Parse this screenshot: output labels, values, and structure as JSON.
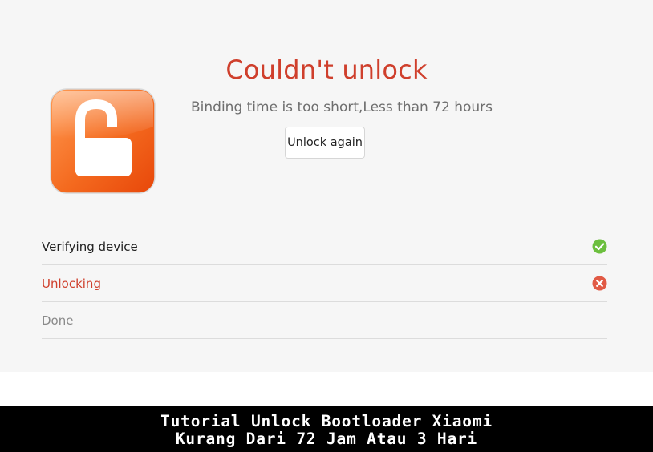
{
  "colors": {
    "panel_bg": "#f6f6f6",
    "title_red": "#cf3f2c",
    "success_green": "#6cbf3e",
    "error_red": "#e15a45",
    "lock_orange_light": "#ff8a3d",
    "lock_orange_dark": "#ee4e0a",
    "banner_bg": "#000000"
  },
  "dialog": {
    "icon": "open-padlock-icon",
    "title": "Couldn't unlock",
    "message": "Binding time is too short,Less than 72 hours",
    "retry_label": "Unlock again"
  },
  "steps": [
    {
      "label": "Verifying device",
      "state": "success",
      "icon": "check-circle-icon",
      "color": "#222222"
    },
    {
      "label": "Unlocking",
      "state": "error",
      "icon": "x-circle-icon",
      "color": "#cf3f2c"
    },
    {
      "label": "Done",
      "state": "pending",
      "icon": "",
      "color": "#8a8a8a"
    }
  ],
  "banner": {
    "line1": "Tutorial Unlock Bootloader Xiaomi",
    "line2": "Kurang Dari 72 Jam Atau 3 Hari"
  }
}
